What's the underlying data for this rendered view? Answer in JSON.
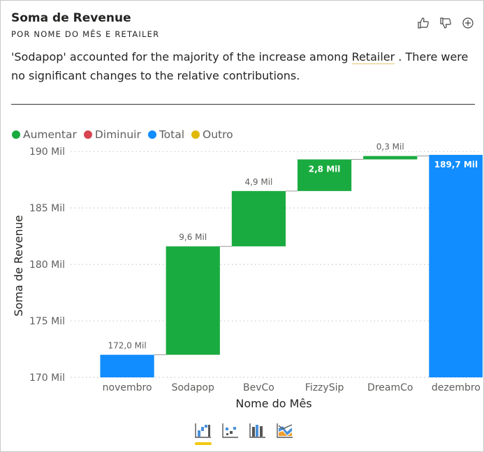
{
  "card": {
    "title": "Soma de Revenue",
    "subtitle": "POR NOME DO MÊS E RETAILER",
    "insight_before": "'Sodapop' accounted for the majority of the increase among ",
    "insight_link": "Retailer",
    "insight_after": " . There were no significant changes to the relative contributions."
  },
  "actions": [
    "thumbs-up-icon",
    "thumbs-down-icon",
    "add-icon"
  ],
  "legend": [
    {
      "label": "Aumentar",
      "color": "#1aab40"
    },
    {
      "label": "Diminuir",
      "color": "#d64550"
    },
    {
      "label": "Total",
      "color": "#118dff"
    },
    {
      "label": "Outro",
      "color": "#e0b80a"
    }
  ],
  "chart_data": {
    "type": "waterfall",
    "xlabel": "Nome do Mês",
    "ylabel": "Soma de Revenue",
    "ylim": [
      170,
      191
    ],
    "yticks": [
      170,
      175,
      180,
      185,
      190
    ],
    "ytick_labels": [
      "170 Mil",
      "175 Mil",
      "180 Mil",
      "185 Mil",
      "190 Mil"
    ],
    "grid": true,
    "legend_position": "top-left",
    "bars": [
      {
        "category": "novembro",
        "kind": "Total",
        "start": 170,
        "end": 172.0,
        "label": "172,0 Mil",
        "label_position": "above"
      },
      {
        "category": "Sodapop",
        "kind": "Aumentar",
        "start": 172.0,
        "end": 181.6,
        "label": "9,6 Mil",
        "label_position": "above"
      },
      {
        "category": "BevCo",
        "kind": "Aumentar",
        "start": 181.6,
        "end": 186.5,
        "label": "4,9 Mil",
        "label_position": "above"
      },
      {
        "category": "FizzySip",
        "kind": "Aumentar",
        "start": 186.5,
        "end": 189.3,
        "label": "2,8 Mil",
        "label_position": "inside"
      },
      {
        "category": "DreamCo",
        "kind": "Aumentar",
        "start": 189.3,
        "end": 189.6,
        "label": "0,3 Mil",
        "label_position": "above"
      },
      {
        "category": "dezembro",
        "kind": "Total",
        "start": 170,
        "end": 189.7,
        "label": "189,7 Mil",
        "label_position": "inside"
      }
    ]
  },
  "visual_switcher": [
    "waterfall-chart-icon",
    "scatter-chart-icon",
    "column-chart-icon",
    "ribbon-chart-icon"
  ]
}
